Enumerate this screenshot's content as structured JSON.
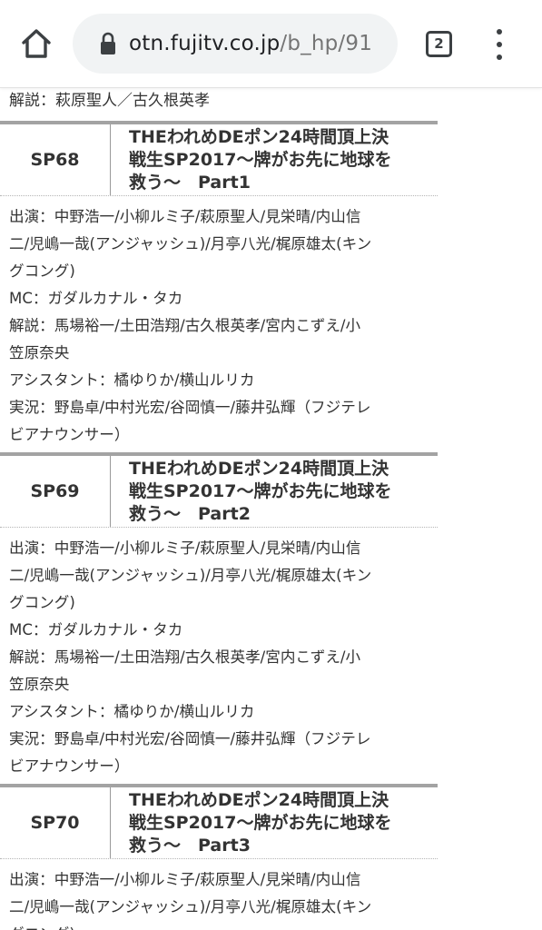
{
  "browser": {
    "url_host": "otn.fujitv.co.jp",
    "url_path": "/b_hp/91",
    "tab_count": "2"
  },
  "page": {
    "top_partial_text": "解説：萩原聖人／古久根英孝",
    "episodes": [
      {
        "number": "SP68",
        "title_lines": [
          "THEわれめDEポン24時間頂上決",
          "戦生SP2017〜牌がお先に地球を",
          "救う〜　Part1"
        ],
        "detail_lines": [
          "出演：中野浩一/小柳ルミ子/萩原聖人/見栄晴/内山信",
          "二/児嶋一哉(アンジャッシュ)/月亭八光/梶原雄太(キン",
          "グコング)",
          "MC：ガダルカナル・タカ",
          "解説：馬場裕一/土田浩翔/古久根英孝/宮内こずえ/小",
          "笠原奈央",
          "アシスタント：橘ゆりか/横山ルリカ",
          "実況：野島卓/中村光宏/谷岡慎一/藤井弘輝（フジテレ",
          "ビアナウンサー）"
        ]
      },
      {
        "number": "SP69",
        "title_lines": [
          "THEわれめDEポン24時間頂上決",
          "戦生SP2017〜牌がお先に地球を",
          "救う〜　Part2"
        ],
        "detail_lines": [
          "出演：中野浩一/小柳ルミ子/萩原聖人/見栄晴/内山信",
          "二/児嶋一哉(アンジャッシュ)/月亭八光/梶原雄太(キン",
          "グコング)",
          "MC：ガダルカナル・タカ",
          "解説：馬場裕一/土田浩翔/古久根英孝/宮内こずえ/小",
          "笠原奈央",
          "アシスタント：橘ゆりか/横山ルリカ",
          "実況：野島卓/中村光宏/谷岡慎一/藤井弘輝（フジテレ",
          "ビアナウンサー）"
        ]
      },
      {
        "number": "SP70",
        "title_lines": [
          "THEわれめDEポン24時間頂上決",
          "戦生SP2017〜牌がお先に地球を",
          "救う〜　Part3"
        ],
        "detail_lines": [
          "出演：中野浩一/小柳ルミ子/萩原聖人/見栄晴/内山信",
          "二/児嶋一哉(アンジャッシュ)/月亭八光/梶原雄太(キン",
          "グコング)"
        ]
      }
    ]
  }
}
